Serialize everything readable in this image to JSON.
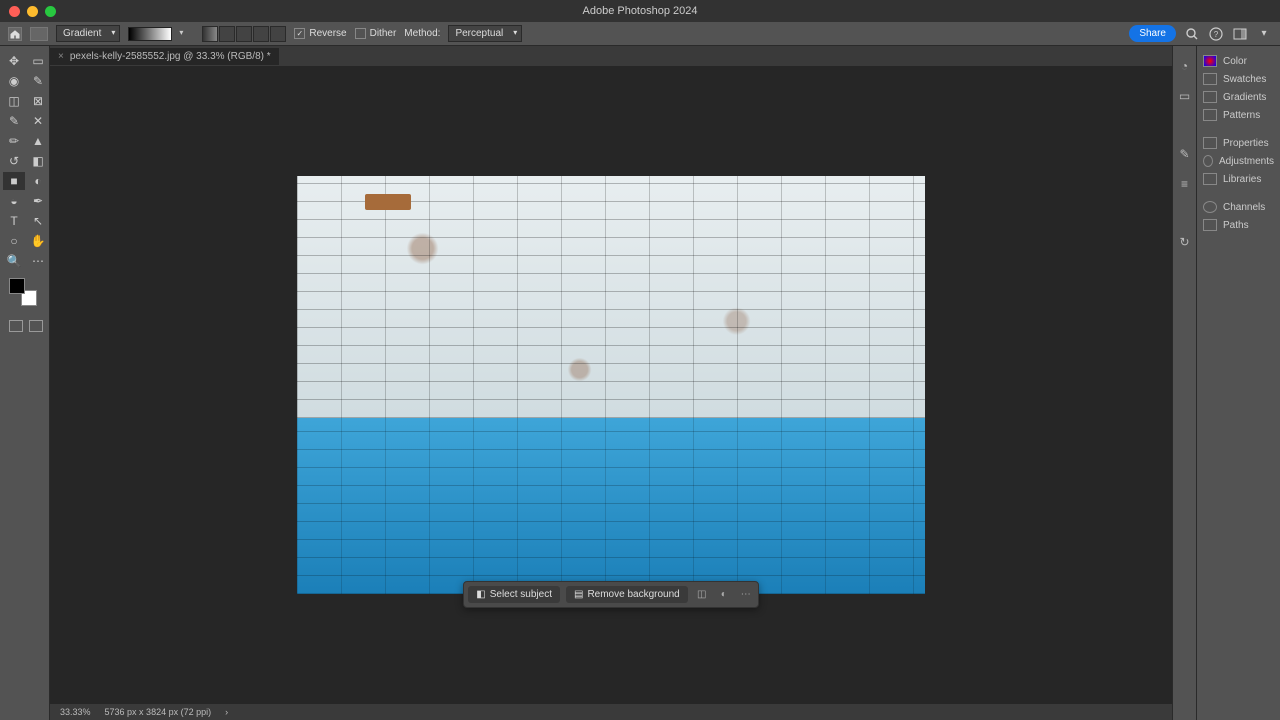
{
  "app_title": "Adobe Photoshop 2024",
  "tab": {
    "name": "pexels-kelly-2585552.jpg @ 33.3% (RGB/8) *"
  },
  "optbar": {
    "tool": "Gradient",
    "reverse": "Reverse",
    "dither": "Dither",
    "method_label": "Method:",
    "method_value": "Perceptual",
    "share": "Share"
  },
  "context": {
    "select_subject": "Select subject",
    "remove_bg": "Remove background"
  },
  "status": {
    "zoom": "33.33%",
    "dims": "5736 px x 3824 px (72 ppi)"
  },
  "rpanel": {
    "color": "Color",
    "swatches": "Swatches",
    "gradients": "Gradients",
    "patterns": "Patterns",
    "properties": "Properties",
    "adjustments": "Adjustments",
    "libraries": "Libraries",
    "channels": "Channels",
    "paths": "Paths"
  },
  "colors": {
    "accent": "#1473e6"
  }
}
